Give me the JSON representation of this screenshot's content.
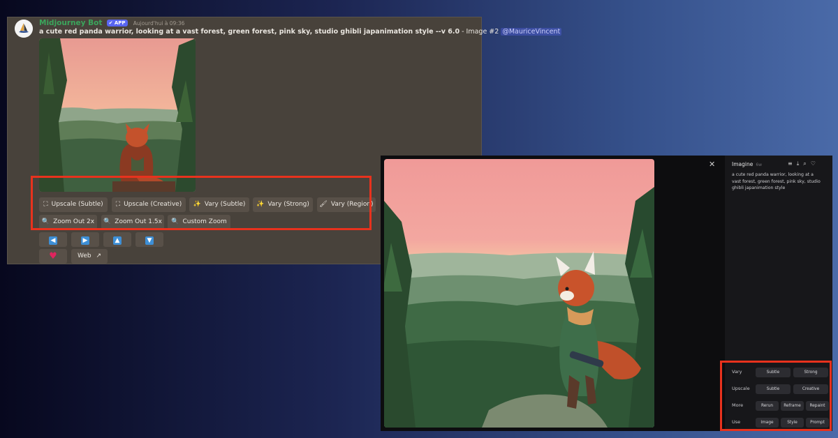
{
  "discord": {
    "bot_name": "Midjourney Bot",
    "app_badge": "APP",
    "timestamp": "Aujourd'hui à 09:36",
    "prompt_bold": "a cute red panda warrior, looking at a vast forest, green forest, pink sky, studio ghibli japanimation style --v 6.0",
    "prompt_suffix": " - Image #2 ",
    "mention": "@MauriceVincent",
    "buttons_row1": [
      {
        "label": "Upscale (Subtle)",
        "icon": "expand-icon"
      },
      {
        "label": "Upscale (Creative)",
        "icon": "expand-icon"
      },
      {
        "label": "Vary (Subtle)",
        "icon": "magic-wand-icon"
      },
      {
        "label": "Vary (Strong)",
        "icon": "magic-wand-icon"
      },
      {
        "label": "Vary (Region)",
        "icon": "paintbrush-icon"
      }
    ],
    "buttons_row2": [
      {
        "label": "Zoom Out 2x",
        "icon": "magnifier-icon"
      },
      {
        "label": "Zoom Out 1.5x",
        "icon": "magnifier-icon"
      },
      {
        "label": "Custom Zoom",
        "icon": "magnifier-icon"
      }
    ],
    "pan_buttons": [
      "arrow-left-icon",
      "arrow-right-icon",
      "arrow-up-icon",
      "arrow-down-icon"
    ],
    "favorite_icon": "heart-icon",
    "web_label": "Web",
    "web_icon": "external-link-icon"
  },
  "web": {
    "close_icon": "close-icon",
    "title": "Imagine",
    "age": "6w",
    "toolbar_icons": [
      "menu-icon",
      "download-icon",
      "search-icon",
      "heart-outline-icon"
    ],
    "prompt": "a cute red panda warrior, looking at a vast forest, green forest, pink sky, studio ghibli japanimation style",
    "rows": [
      {
        "label": "Vary",
        "options": [
          "Subtle",
          "Strong"
        ]
      },
      {
        "label": "Upscale",
        "options": [
          "Subtle",
          "Creative"
        ]
      },
      {
        "label": "More",
        "options": [
          "Rerun",
          "Reframe",
          "Repaint"
        ]
      },
      {
        "label": "Use",
        "options": [
          "Image",
          "Style",
          "Prompt"
        ]
      }
    ]
  },
  "colors": {
    "highlight": "#e8321d",
    "discord_bg": "#48423b",
    "bot_name": "#3ba55c",
    "app_badge": "#5865f2",
    "web_bg": "#0d0d0f"
  }
}
